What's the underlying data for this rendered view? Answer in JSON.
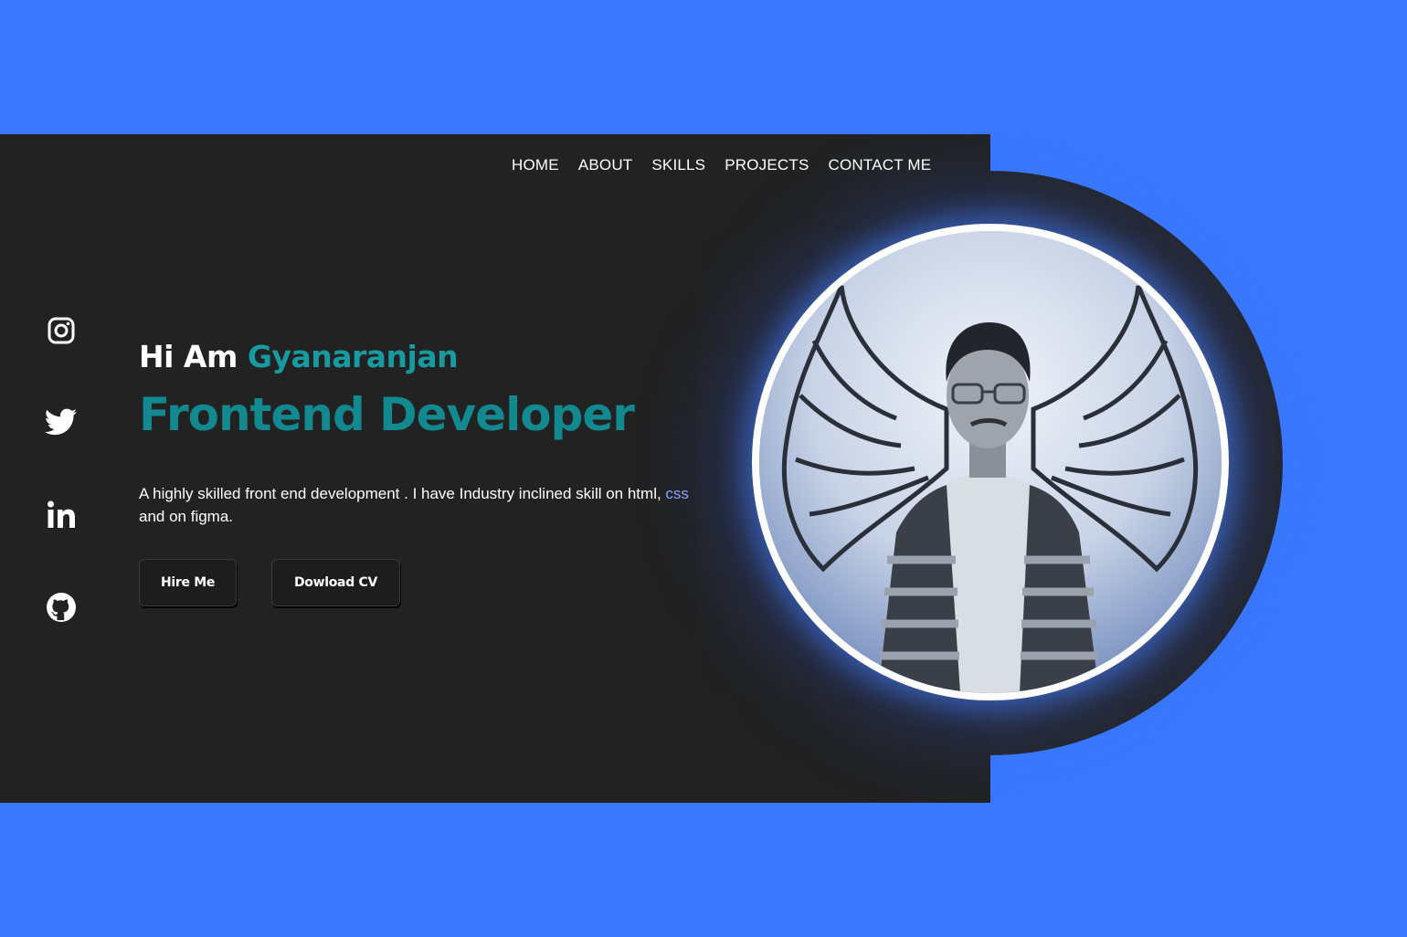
{
  "nav": {
    "items": [
      "HOME",
      "ABOUT",
      "SKILLS",
      "PROJECTS",
      "CONTACT ME"
    ]
  },
  "social": {
    "icons": [
      "instagram-icon",
      "twitter-icon",
      "linkedin-icon",
      "github-icon"
    ]
  },
  "hero": {
    "greeting": "Hi Am ",
    "name": "Gyanaranjan",
    "role": "Frontend Developer",
    "description_line1": "A highly skilled front end development . I have Industry inclined skill on html, ",
    "description_highlight": "css",
    "description_line2": "and on figma."
  },
  "buttons": {
    "hire": "Hire Me",
    "cv": "Dowload CV"
  },
  "colors": {
    "background": "#3a78fe",
    "panel": "#222222",
    "accent": "#12898e",
    "glow": "#4a86ff"
  }
}
